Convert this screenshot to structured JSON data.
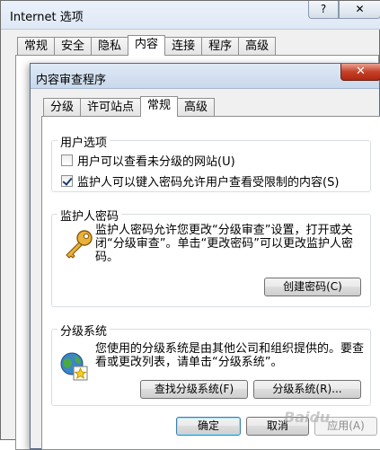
{
  "outer_window": {
    "title": "Internet 选项",
    "help_label": "?",
    "close_label": "✕",
    "tabs": [
      {
        "label": "常规"
      },
      {
        "label": "安全"
      },
      {
        "label": "隐私"
      },
      {
        "label": "内容",
        "active": true
      },
      {
        "label": "连接"
      },
      {
        "label": "程序"
      },
      {
        "label": "高级"
      }
    ]
  },
  "dialog": {
    "title": "内容审查程序",
    "close_label": "✕",
    "tabs": [
      {
        "label": "分级"
      },
      {
        "label": "许可站点"
      },
      {
        "label": "常规",
        "active": true
      },
      {
        "label": "高级"
      }
    ],
    "user_options": {
      "label": "用户选项",
      "option1": {
        "label": "用户可以查看未分级的网站(U)",
        "checked": false
      },
      "option2": {
        "label": "监护人可以键入密码允许用户查看受限制的内容(S)",
        "checked": true
      }
    },
    "supervisor_password": {
      "label": "监护人密码",
      "icon": "key-icon",
      "text": "监护人密码允许您更改“分级审查”设置，打开或关闭“分级审查”。单击“更改密码”可以更改监护人密码。",
      "create_button": "创建密码(C)"
    },
    "rating_systems": {
      "label": "分级系统",
      "icon": "globe-star-icon",
      "text": "您使用的分级系统是由其他公司和组织提供的。要查看或更改列表，请单击“分级系统”。",
      "find_button": "查找分级系统(F)",
      "systems_button": "分级系统(R)..."
    }
  },
  "footer": {
    "ok": "确定",
    "cancel": "取消",
    "apply": "应用(A)"
  },
  "watermark": "Baidu"
}
